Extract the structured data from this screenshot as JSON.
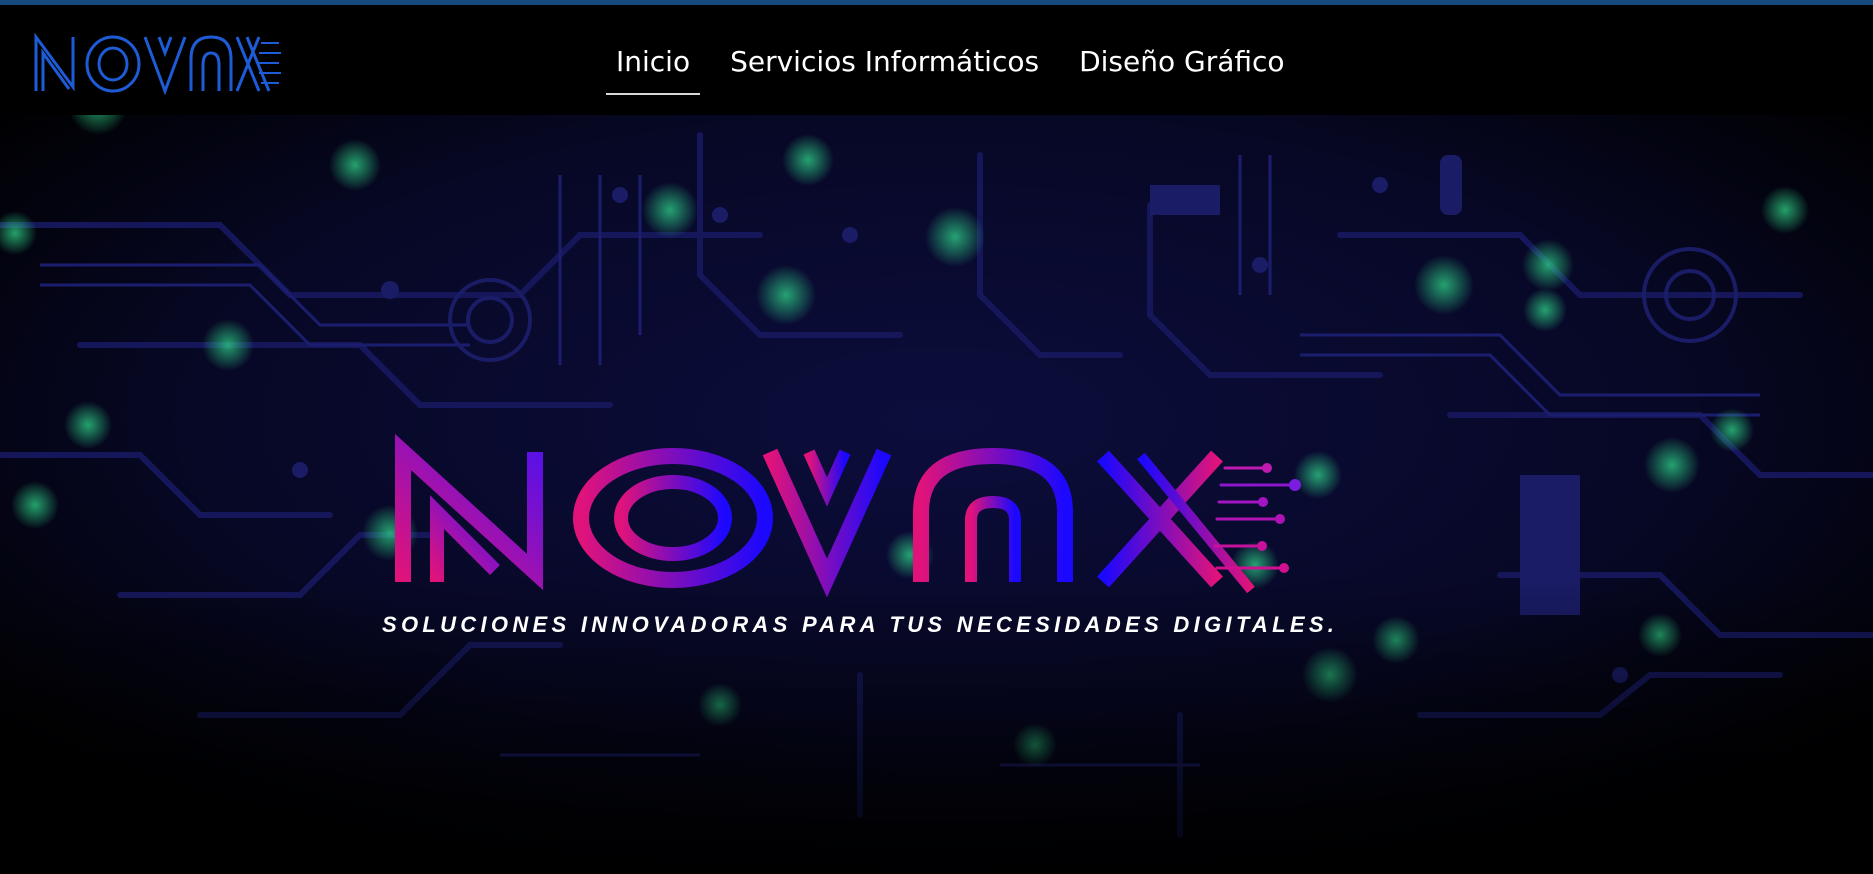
{
  "brand": {
    "logo_text": "NOVAX",
    "nav_logo_color": "#1e5bd6",
    "hero_gradient": [
      "#e1137a",
      "#1400ff"
    ]
  },
  "nav": {
    "items": [
      {
        "label": "Inicio",
        "active": true
      },
      {
        "label": "Servicios Informáticos",
        "active": false
      },
      {
        "label": "Diseño Gráfico",
        "active": false
      }
    ]
  },
  "hero": {
    "tagline": "SOLUCIONES INNOVADORAS PARA TUS NECESIDADES DIGITALES.",
    "background": "circuit-board",
    "bg_colors": [
      "#000000",
      "#0a0b3a",
      "#1f8f5a"
    ]
  }
}
